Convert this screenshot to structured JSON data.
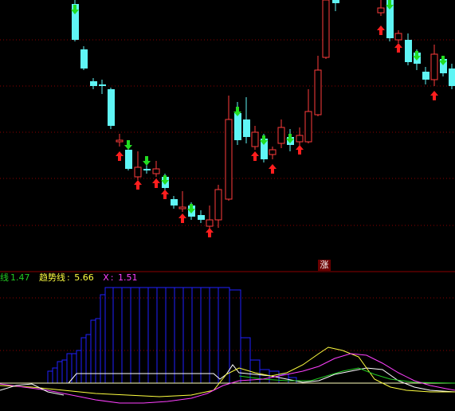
{
  "colors": {
    "background": "#000000",
    "up_candle": "#ff3b3b",
    "down_candle": "#5ff5f5",
    "grid": "#8b0000",
    "signal_up": "#ff1e1e",
    "signal_down": "#22dd22",
    "bar_outline": "#2020ff",
    "line_white": "#ffffff",
    "line_yellow": "#ffff40",
    "line_green": "#22cc22",
    "line_magenta": "#ff40ff",
    "line_baseline": "#ffffbb"
  },
  "indicator_legend": {
    "line1_label": "线",
    "line1_value": "1.47",
    "line2_label": "趋势线",
    "line2_value": "5.66",
    "line3_label": "X",
    "line3_value": "1.51"
  },
  "price_tag": "涨",
  "icons": {
    "up_arrow": "red-up-arrow-icon",
    "down_arrow": "green-down-arrow-icon"
  }
}
